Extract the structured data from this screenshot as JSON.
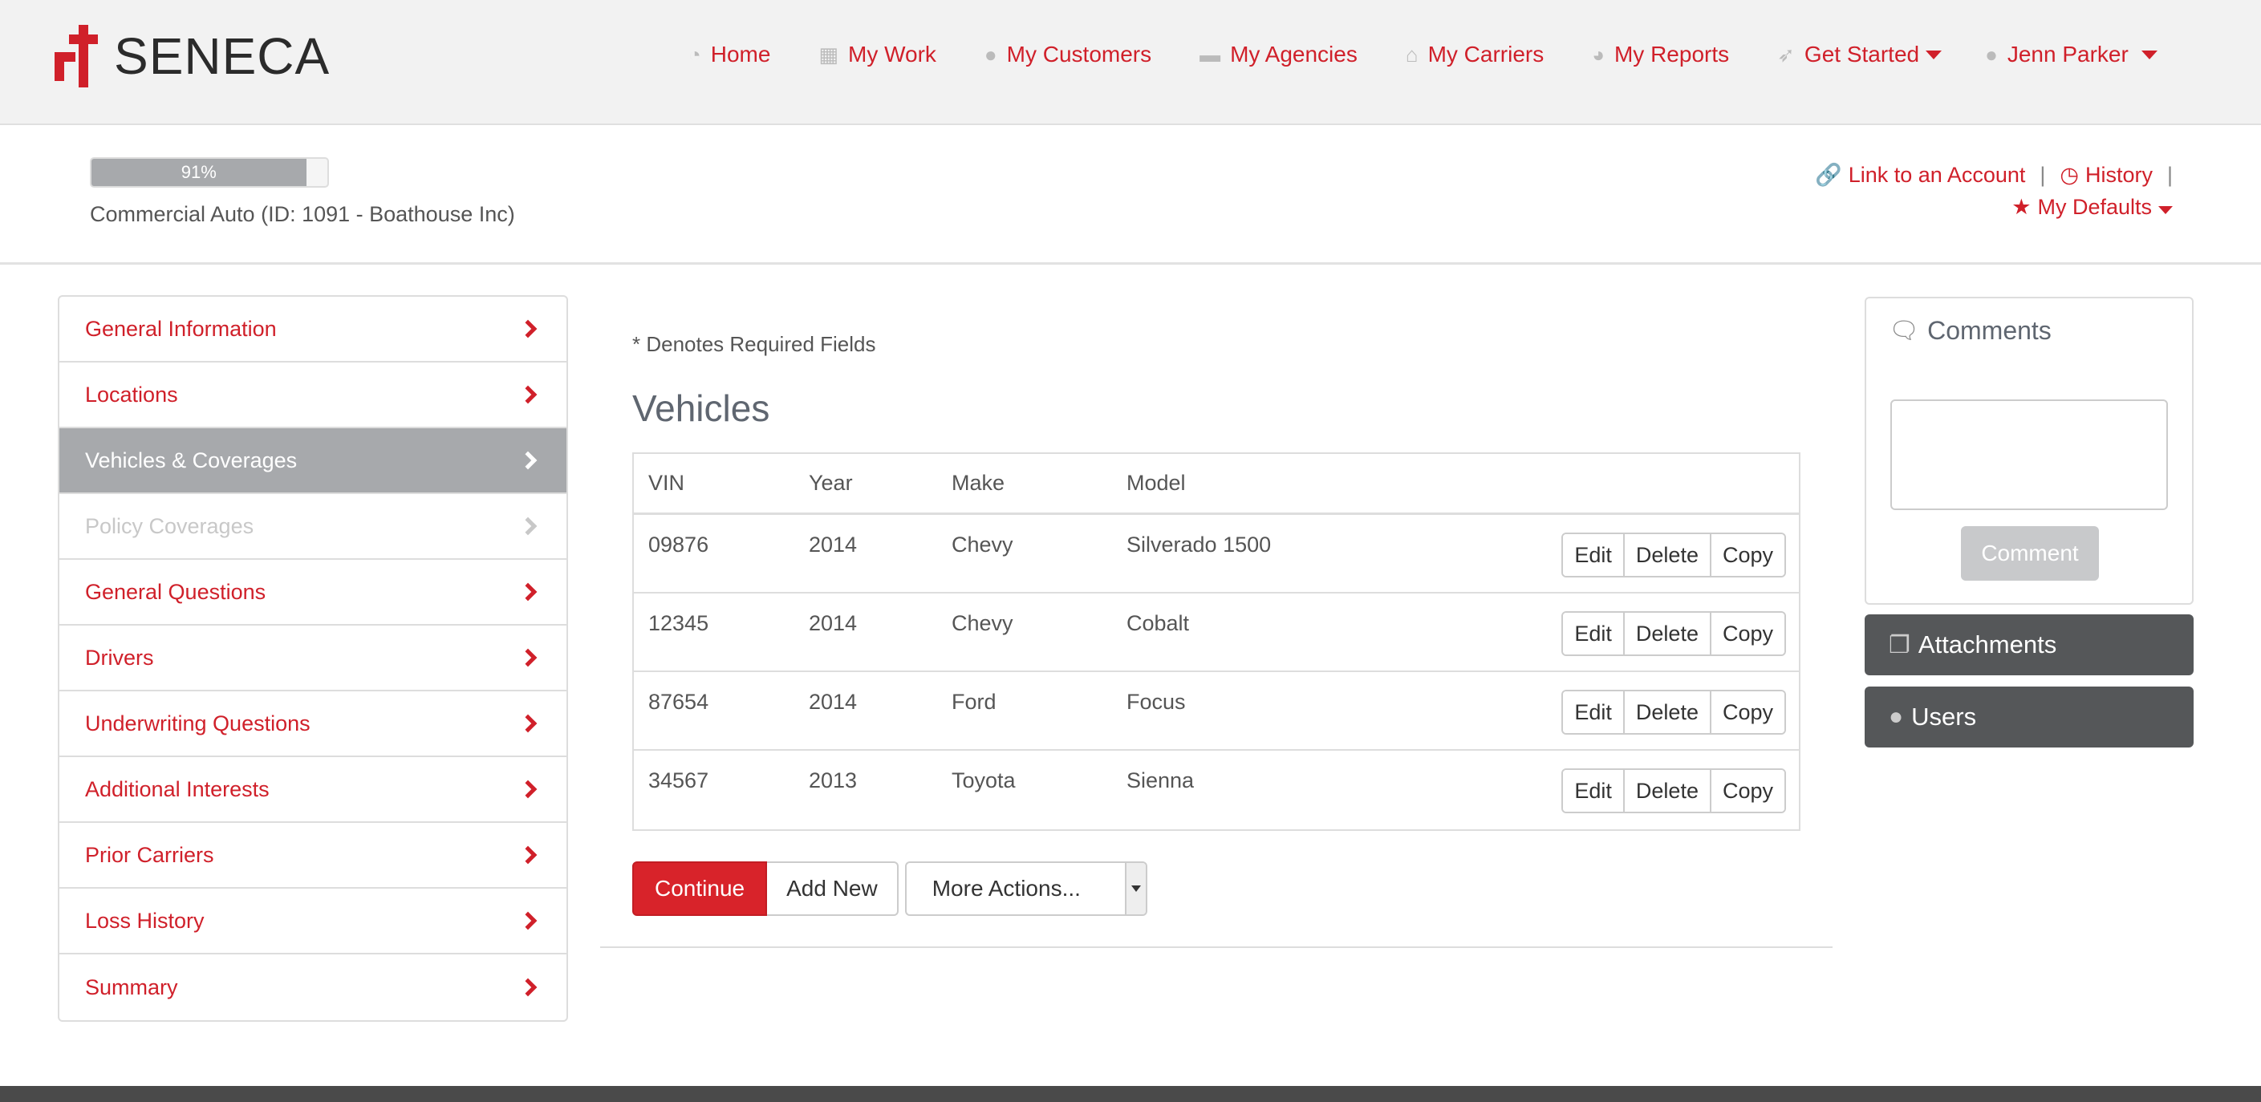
{
  "brand": {
    "name": "SENECA",
    "color": "#d0202a"
  },
  "nav": {
    "items": [
      {
        "label": "Home",
        "icon": "dashboard-icon"
      },
      {
        "label": "My Work",
        "icon": "grid-icon"
      },
      {
        "label": "My Customers",
        "icon": "users-icon"
      },
      {
        "label": "My Agencies",
        "icon": "briefcase-icon"
      },
      {
        "label": "My Carriers",
        "icon": "bank-icon"
      },
      {
        "label": "My Reports",
        "icon": "pie-chart-icon"
      },
      {
        "label": "Get Started",
        "icon": "rocket-icon"
      },
      {
        "label": "Jenn Parker",
        "icon": "user-icon"
      }
    ]
  },
  "progress": {
    "value": 0.91,
    "label": "91%"
  },
  "policy_label": "Commercial Auto (ID: 1091 - Boathouse Inc)",
  "header_links": {
    "link_account": "Link to an Account",
    "history": "History",
    "my_defaults": "My Defaults"
  },
  "sidebar": {
    "items": [
      {
        "label": "General Information",
        "state": "normal"
      },
      {
        "label": "Locations",
        "state": "normal"
      },
      {
        "label": "Vehicles & Coverages",
        "state": "active"
      },
      {
        "label": "Policy Coverages",
        "state": "disabled"
      },
      {
        "label": "General Questions",
        "state": "normal"
      },
      {
        "label": "Drivers",
        "state": "normal"
      },
      {
        "label": "Underwriting Questions",
        "state": "normal"
      },
      {
        "label": "Additional Interests",
        "state": "normal"
      },
      {
        "label": "Prior Carriers",
        "state": "normal"
      },
      {
        "label": "Loss History",
        "state": "normal"
      },
      {
        "label": "Summary",
        "state": "normal"
      }
    ]
  },
  "main": {
    "required_note": "* Denotes Required Fields",
    "title": "Vehicles",
    "columns": [
      "VIN",
      "Year",
      "Make",
      "Model"
    ],
    "rows": [
      {
        "vin": "09876",
        "year": "2014",
        "make": "Chevy",
        "model": "Silverado 1500"
      },
      {
        "vin": "12345",
        "year": "2014",
        "make": "Chevy",
        "model": "Cobalt"
      },
      {
        "vin": "87654",
        "year": "2014",
        "make": "Ford",
        "model": "Focus"
      },
      {
        "vin": "34567",
        "year": "2013",
        "make": "Toyota",
        "model": "Sienna"
      }
    ],
    "row_actions": {
      "edit": "Edit",
      "delete": "Delete",
      "copy": "Copy"
    },
    "continue": "Continue",
    "add_new": "Add New",
    "more_actions": "More Actions..."
  },
  "comments": {
    "title": "Comments",
    "button": "Comment"
  },
  "attachments": "Attachments",
  "users": "Users"
}
